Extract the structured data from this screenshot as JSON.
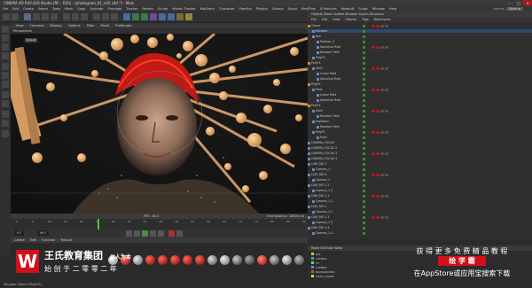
{
  "window": {
    "title": "CINEMA 4D R20.026 Studio (RC - R20) - [photogram_01_v02.c4d *] - Main",
    "controls": [
      "–",
      "□",
      "✕"
    ]
  },
  "menu": {
    "items": [
      "File",
      "Edit",
      "Create",
      "Select",
      "Tools",
      "Mesh",
      "Snap",
      "Animate",
      "Simulate",
      "Tracker",
      "Render",
      "Sculpt",
      "Motion Tracker",
      "MoGraph",
      "Character",
      "Pipeline",
      "Plugins",
      "Octane",
      "Script",
      "RealFlow",
      "X-Particles",
      "Redshift",
      "Script",
      "Window",
      "Help"
    ],
    "layout_label": "Layout:",
    "layout_value": "Startup"
  },
  "viewport": {
    "menu": [
      "View",
      "Cameras",
      "Display",
      "Options",
      "Filter",
      "Panel",
      "ProRender"
    ],
    "header": "Perspective",
    "subtab": "Default",
    "status_left": "",
    "status_mid": "FPS : 60.3",
    "status_right": "Grid Spacing : 10000 cm"
  },
  "timeline": {
    "ticks": [
      "0",
      "5",
      "10",
      "15",
      "20",
      "25",
      "30",
      "35",
      "40",
      "45",
      "50",
      "55",
      "60",
      "65",
      "70",
      "75",
      "80",
      "85",
      "90"
    ],
    "frame_start": "0 F",
    "frame_end": "90 F"
  },
  "materials": {
    "tabs": [
      "Create",
      "Edit",
      "Function",
      "Texture"
    ]
  },
  "statusbar": {
    "text": "Polygon Object [PolyFX]"
  },
  "object_manager": {
    "tabs_label": "Objects  Takes  Content Browser  Layers  Structure",
    "menu": [
      "File",
      "Edit",
      "View",
      "Objects",
      "Tags",
      "Bookmarks"
    ],
    "rows": [
      {
        "name": "Cloner",
        "indent": 0,
        "dot": "#ff8a00"
      },
      {
        "name": "Random",
        "indent": 1,
        "dot": ""
      },
      {
        "name": "Null",
        "indent": 1,
        "dot": ""
      },
      {
        "name": "Position_2",
        "indent": 2,
        "dot": ""
      },
      {
        "name": "Spherical Field",
        "indent": 2,
        "dot": ""
      },
      {
        "name": "Random Field",
        "indent": 2,
        "dot": ""
      },
      {
        "name": "PolyFX",
        "indent": 1,
        "dot": ""
      },
      {
        "name": "PolyFX",
        "indent": 0,
        "dot": "#ff8a00"
      },
      {
        "name": "Shell",
        "indent": 1,
        "dot": ""
      },
      {
        "name": "Linear Field",
        "indent": 2,
        "dot": ""
      },
      {
        "name": "Spherical Field",
        "indent": 2,
        "dot": ""
      },
      {
        "name": "PolyFX",
        "indent": 0,
        "dot": "#ff8a00"
      },
      {
        "name": "Plain",
        "indent": 1,
        "dot": ""
      },
      {
        "name": "Linear Field",
        "indent": 2,
        "dot": ""
      },
      {
        "name": "Spherical Field",
        "indent": 2,
        "dot": ""
      },
      {
        "name": "PolyFX",
        "indent": 0,
        "dot": "#ff8a00"
      },
      {
        "name": "Shell",
        "indent": 1,
        "dot": ""
      },
      {
        "name": "Random Field",
        "indent": 2,
        "dot": ""
      },
      {
        "name": "Explosion",
        "indent": 1,
        "dot": ""
      },
      {
        "name": "Random Field",
        "indent": 2,
        "dot": ""
      },
      {
        "name": "PolyFX",
        "indent": 1,
        "dot": ""
      },
      {
        "name": "Plain",
        "indent": 2,
        "dot": ""
      },
      {
        "name": "CAMERA_FOCUS",
        "indent": 0,
        "dot": ""
      },
      {
        "name": "CAMERA_FOCUS 2",
        "indent": 0,
        "dot": ""
      },
      {
        "name": "CAMERA_FOCUS 3",
        "indent": 0,
        "dot": ""
      },
      {
        "name": "CAMERA_FOCUS 4",
        "indent": 0,
        "dot": ""
      },
      {
        "name": "CAM_RIG 7",
        "indent": 0,
        "dot": ""
      },
      {
        "name": "Camera_1",
        "indent": 1,
        "dot": ""
      },
      {
        "name": "CAM_RIG 6",
        "indent": 0,
        "dot": ""
      },
      {
        "name": "Camera_1",
        "indent": 1,
        "dot": ""
      },
      {
        "name": "CAM_RIG 1.2",
        "indent": 0,
        "dot": ""
      },
      {
        "name": "Camera_1.3",
        "indent": 1,
        "dot": ""
      },
      {
        "name": "CAM_RIG 1.1",
        "indent": 0,
        "dot": ""
      },
      {
        "name": "Camera_1.1",
        "indent": 1,
        "dot": ""
      },
      {
        "name": "CAM_RIG 1",
        "indent": 0,
        "dot": ""
      },
      {
        "name": "Camera_1.1",
        "indent": 1,
        "dot": ""
      },
      {
        "name": "CAM_RIG 1.3",
        "indent": 0,
        "dot": ""
      },
      {
        "name": "Camera_1.3",
        "indent": 1,
        "dot": ""
      },
      {
        "name": "CAM_RIG 1.4",
        "indent": 0,
        "dot": ""
      },
      {
        "name": "Camera_1.4",
        "indent": 1,
        "dot": ""
      }
    ]
  },
  "attributes": {
    "tabs_label": "Mode  Edit  User Data",
    "rows": [
      "PLS",
      "CAMERA",
      "FX",
      "CAMERA",
      "BACKGROUND",
      "LIGHT_SCENE"
    ]
  },
  "watermark": {
    "logo_text": "W",
    "left_line1": "王氏教育集团",
    "left_line1_en": "以人为本",
    "left_line2": "始 创 于 二 零 零 二 年",
    "right_line1": "获 得 更 多 免 费 精 品 教 程",
    "right_badge": "绘 学 霸",
    "right_line3": "在AppStore或应用宝搜索下载"
  },
  "colors": {
    "accent": "#ff8a00",
    "selection": "#2d4a6e",
    "badge_red": "#d0101a"
  }
}
